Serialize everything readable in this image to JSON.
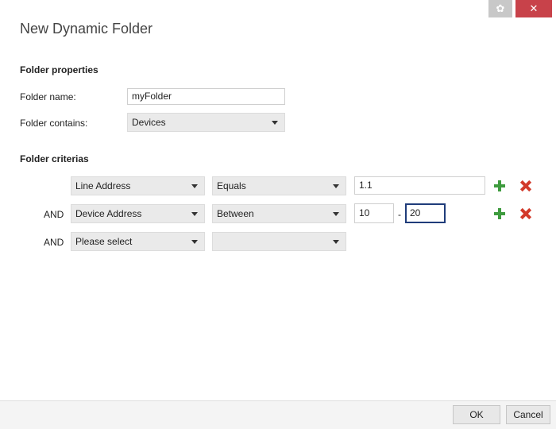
{
  "window": {
    "title": "New Dynamic Folder",
    "settings_icon": "gear-icon",
    "close_icon": "close-icon"
  },
  "properties": {
    "heading": "Folder properties",
    "name_label": "Folder name:",
    "name_value": "myFolder",
    "contains_label": "Folder contains:",
    "contains_value": "Devices"
  },
  "criteria": {
    "heading": "Folder criterias",
    "rows": [
      {
        "connector": "",
        "field": "Line Address",
        "operator": "Equals",
        "value": "1.1"
      },
      {
        "connector": "AND",
        "field": "Device Address",
        "operator": "Between",
        "value_from": "10",
        "range_separator": "-",
        "value_to": "20"
      },
      {
        "connector": "AND",
        "field": "Please select",
        "operator": ""
      }
    ]
  },
  "footer": {
    "ok_label": "OK",
    "cancel_label": "Cancel"
  },
  "colors": {
    "close_button": "#c8424a",
    "add_icon": "#3e9b3e",
    "remove_icon": "#d23a2a",
    "focus_border": "#1f3c7a"
  }
}
